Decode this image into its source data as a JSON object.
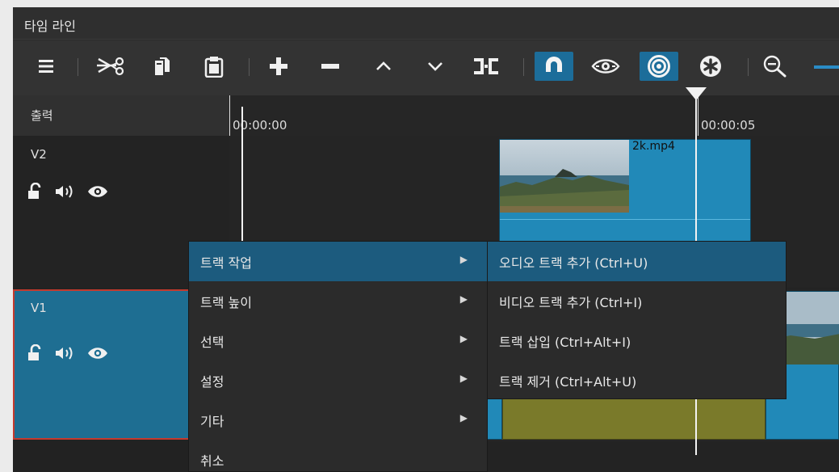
{
  "window": {
    "title": "타임 라인"
  },
  "toolbar": {
    "items": [
      {
        "name": "menu-icon",
        "active": false
      },
      {
        "name": "cut-icon",
        "active": false
      },
      {
        "name": "copy-icon",
        "active": false
      },
      {
        "name": "paste-icon",
        "active": false
      },
      {
        "name": "plus-icon",
        "active": false
      },
      {
        "name": "minus-icon",
        "active": false
      },
      {
        "name": "lift-icon",
        "active": false
      },
      {
        "name": "overwrite-icon",
        "active": false
      },
      {
        "name": "split-icon",
        "active": false
      },
      {
        "name": "snap-magnet-icon",
        "active": true
      },
      {
        "name": "scrub-eye-icon",
        "active": false
      },
      {
        "name": "ripple-target-icon",
        "active": true
      },
      {
        "name": "ripple-all-icon",
        "active": false
      },
      {
        "name": "zoom-out-icon",
        "active": false
      }
    ]
  },
  "tracks": {
    "output_label": "출력",
    "v2": {
      "name": "V2"
    },
    "v1": {
      "name": "V1"
    }
  },
  "ruler": {
    "start": "00:00:00",
    "mark": "00:00:05"
  },
  "clips": {
    "v2_clip": {
      "label": "2k.mp4"
    }
  },
  "context_menu": {
    "items": [
      {
        "label": "트랙 작업",
        "submenu": true,
        "highlighted": true
      },
      {
        "label": "트랙 높이",
        "submenu": true,
        "highlighted": false
      },
      {
        "label": "선택",
        "submenu": true,
        "highlighted": false
      },
      {
        "label": "설정",
        "submenu": true,
        "highlighted": false
      },
      {
        "label": "기타",
        "submenu": true,
        "highlighted": false
      },
      {
        "label": "취소",
        "submenu": false,
        "highlighted": false
      }
    ],
    "arrow": "▶"
  },
  "submenu": {
    "items": [
      {
        "label": "오디오 트랙 추가 (Ctrl+U)",
        "highlighted": true
      },
      {
        "label": "비디오 트랙 추가 (Ctrl+I)",
        "highlighted": false
      },
      {
        "label": "트랙 삽입 (Ctrl+Alt+I)",
        "highlighted": false
      },
      {
        "label": "트랙 제거 (Ctrl+Alt+U)",
        "highlighted": false
      }
    ]
  },
  "colors": {
    "accent": "#1c6d9a",
    "selected_track": "#1e6e92",
    "selected_border": "#c43a2e",
    "clip": "#2189b8",
    "audio_clip": "#7a7a2a",
    "menu_highlight": "#1c5b7e"
  }
}
